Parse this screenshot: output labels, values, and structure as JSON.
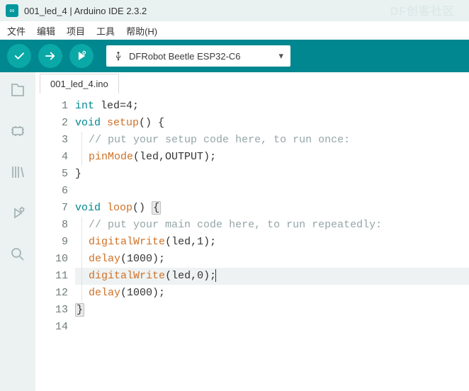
{
  "title": "001_led_4 | Arduino IDE 2.3.2",
  "watermark": "DF创客社区",
  "menu": {
    "file": "文件",
    "edit": "编辑",
    "project": "项目",
    "tools": "工具",
    "help": "帮助(H)"
  },
  "board": "DFRobot Beetle ESP32-C6",
  "tab": "001_led_4.ino",
  "code": [
    {
      "n": 1,
      "type": "code",
      "indent": 0,
      "html": "<span class='k-type'>int</span> <span class='k-txt'>led=4;</span>"
    },
    {
      "n": 2,
      "type": "code",
      "indent": 0,
      "html": "<span class='k-kw'>void</span> <span class='k-fn'>setup</span><span class='k-txt'>() {</span>"
    },
    {
      "n": 3,
      "type": "cmt",
      "indent": 1,
      "text": "// put your setup code here, to run once:"
    },
    {
      "n": 4,
      "type": "code",
      "indent": 1,
      "html": "<span class='k-fn'>pinMode</span><span class='k-txt'>(led,OUTPUT);</span>"
    },
    {
      "n": 5,
      "type": "code",
      "indent": 0,
      "html": "<span class='k-txt'>}</span>"
    },
    {
      "n": 6,
      "type": "code",
      "indent": 0,
      "html": ""
    },
    {
      "n": 7,
      "type": "code",
      "indent": 0,
      "html": "<span class='k-kw'>void</span> <span class='k-fn'>loop</span><span class='k-txt'>() </span><span class='brace-match k-txt'>{</span>"
    },
    {
      "n": 8,
      "type": "cmt",
      "indent": 1,
      "text": "// put your main code here, to run repeatedly:"
    },
    {
      "n": 9,
      "type": "code",
      "indent": 1,
      "html": "<span class='k-fn'>digitalWrite</span><span class='k-txt'>(led,1);</span>"
    },
    {
      "n": 10,
      "type": "code",
      "indent": 1,
      "html": "<span class='k-fn'>delay</span><span class='k-txt'>(1000);</span>"
    },
    {
      "n": 11,
      "type": "code",
      "indent": 1,
      "hl": true,
      "cursor": true,
      "html": "<span class='k-fn'>digitalWrite</span><span class='k-txt'>(led,0);</span>"
    },
    {
      "n": 12,
      "type": "code",
      "indent": 1,
      "html": "<span class='k-fn'>delay</span><span class='k-txt'>(1000);</span>"
    },
    {
      "n": 13,
      "type": "code",
      "indent": 0,
      "html": "<span class='brace-match k-txt'>}</span>"
    },
    {
      "n": 14,
      "type": "code",
      "indent": 0,
      "html": ""
    }
  ]
}
